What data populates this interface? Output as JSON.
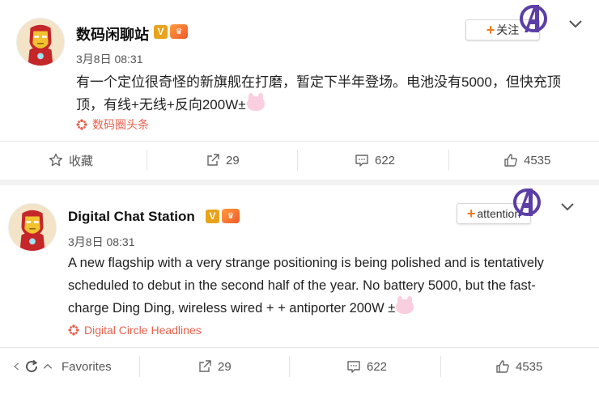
{
  "posts": [
    {
      "username": "数码闲聊站",
      "badge_v": "V",
      "timestamp": "3月8日 08:31",
      "content_line1": "有一个定位很奇怪的新旗舰在打磨，暂定下半年登场。电池没有5000，但快充顶",
      "content_line2": "顶，有线+无线+反向200W±",
      "source": "数码圈头条",
      "follow_label": "关注",
      "actions": {
        "favorite": "收藏",
        "repost": "29",
        "comment": "622",
        "like": "4535"
      }
    },
    {
      "username": "Digital Chat Station",
      "badge_v": "V",
      "timestamp": "3月8日 08:31",
      "content_line1": "A new flagship with a very strange positioning is being polished and is tentatively",
      "content_line2": "scheduled to debut in the second half of the year. No battery 5000, but the fast-",
      "content_line3": "charge Ding Ding, wireless wired + + antiporter 200W ±",
      "source": "Digital Circle Headlines",
      "follow_label": "attention",
      "actions": {
        "favorite": "Favorites",
        "repost": "29",
        "comment": "622",
        "like": "4535"
      }
    }
  ],
  "colors": {
    "accent_orange": "#f07a1b",
    "source_red": "#e8624e",
    "badge_gold": "#e8a21b",
    "brand_purple": "#5b3ea6"
  },
  "icons": [
    "avatar-iron-man",
    "v-badge",
    "crown-badge",
    "source-icon",
    "brand-mark-icon",
    "chevron-down-icon",
    "star-icon",
    "repost-icon",
    "comment-icon",
    "like-icon",
    "refresh-icon",
    "chevron-up-icon"
  ]
}
